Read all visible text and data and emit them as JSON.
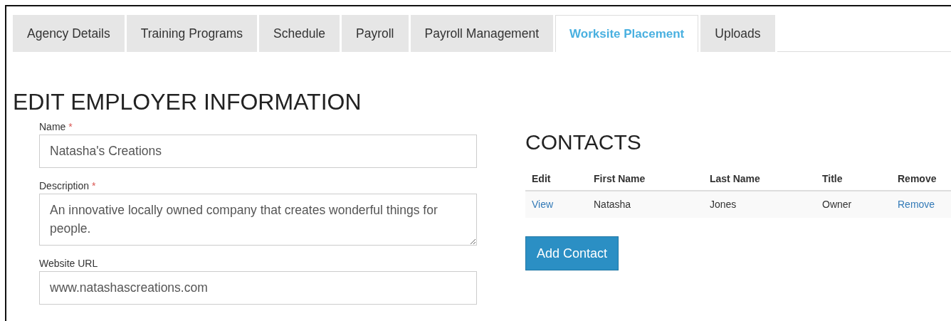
{
  "tabs": [
    {
      "label": "Agency Details",
      "selected": false
    },
    {
      "label": "Training Programs",
      "selected": false
    },
    {
      "label": "Schedule",
      "selected": false
    },
    {
      "label": "Payroll",
      "selected": false
    },
    {
      "label": "Payroll Management",
      "selected": false
    },
    {
      "label": "Worksite Placement",
      "selected": true
    },
    {
      "label": "Uploads",
      "selected": false
    }
  ],
  "page_title": "EDIT EMPLOYER INFORMATION",
  "form": {
    "fields": [
      {
        "label": "Name",
        "required_mark": "*",
        "kind": "input",
        "value": "Natasha's Creations"
      },
      {
        "label": "Description",
        "required_mark": "*",
        "kind": "textarea",
        "value": "An innovative locally owned company that creates wonderful things for people."
      },
      {
        "label": "Website URL",
        "kind": "input",
        "value": "www.natashascreations.com"
      }
    ]
  },
  "contacts": {
    "title": "CONTACTS",
    "columns": [
      "Edit",
      "First Name",
      "Last Name",
      "Title",
      "Remove"
    ],
    "rows": [
      {
        "edit": "View",
        "first_name": "Natasha",
        "last_name": "Jones",
        "title": "Owner",
        "remove": "Remove"
      }
    ],
    "add_button": "Add Contact"
  }
}
